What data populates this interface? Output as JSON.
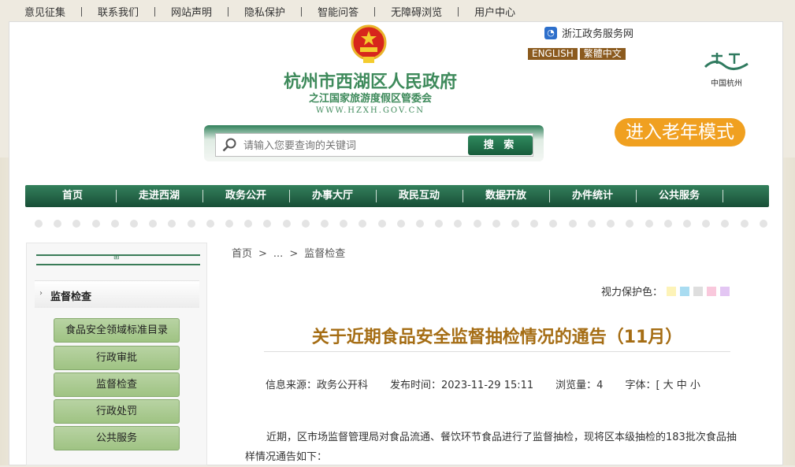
{
  "topbar": {
    "links": [
      "意见征集",
      "联系我们",
      "网站声明",
      "隐私保护",
      "智能问答",
      "无障碍浏览",
      "用户中心"
    ]
  },
  "header": {
    "title": "杭州市西湖区人民政府",
    "subtitle": "之江国家旅游度假区管委会",
    "url": "WWW.HZXH.GOV.CN",
    "zj_service": "浙江政务服务网",
    "lang_english": "ENGLISH",
    "lang_traditional": "繁體中文",
    "hz_logo_text": "中国杭州",
    "elder_mode": "进入老年模式"
  },
  "search": {
    "placeholder": "请输入您要查询的关键词",
    "button": "搜 索"
  },
  "nav": {
    "items": [
      "首页",
      "走进西湖",
      "政务公开",
      "办事大厅",
      "政民互动",
      "数据开放",
      "办件统计",
      "公共服务"
    ]
  },
  "sidebar": {
    "heading": "监督检查",
    "items": [
      "食品安全领域标准目录",
      "行政审批",
      "监督检查",
      "行政处罚",
      "公共服务"
    ]
  },
  "breadcrumb": {
    "home": "首页",
    "sep1": ">",
    "mid": "...",
    "sep2": ">",
    "current": "监督检查"
  },
  "vision": {
    "label": "视力保护色：",
    "colors": [
      "#fdf3b8",
      "#a9dcf1",
      "#dedede",
      "#f9c8dc",
      "#e3c6f3"
    ]
  },
  "article": {
    "title": "关于近期食品安全监督抽检情况的通告（11月）",
    "source": "信息来源：政务公开科",
    "published": "发布时间：2023-11-29 15:11",
    "views": "浏览量：4",
    "font_size": "字体：[ 大 中 小",
    "body": "近期，区市场监督管理局对食品流通、餐饮环节食品进行了监督抽检，现将区本级抽检的183批次食品抽样情况通告如下："
  },
  "colors": {
    "brand_green": "#3e8a5b",
    "title_brown": "#a56d14",
    "elder_orange": "#f0a020"
  }
}
